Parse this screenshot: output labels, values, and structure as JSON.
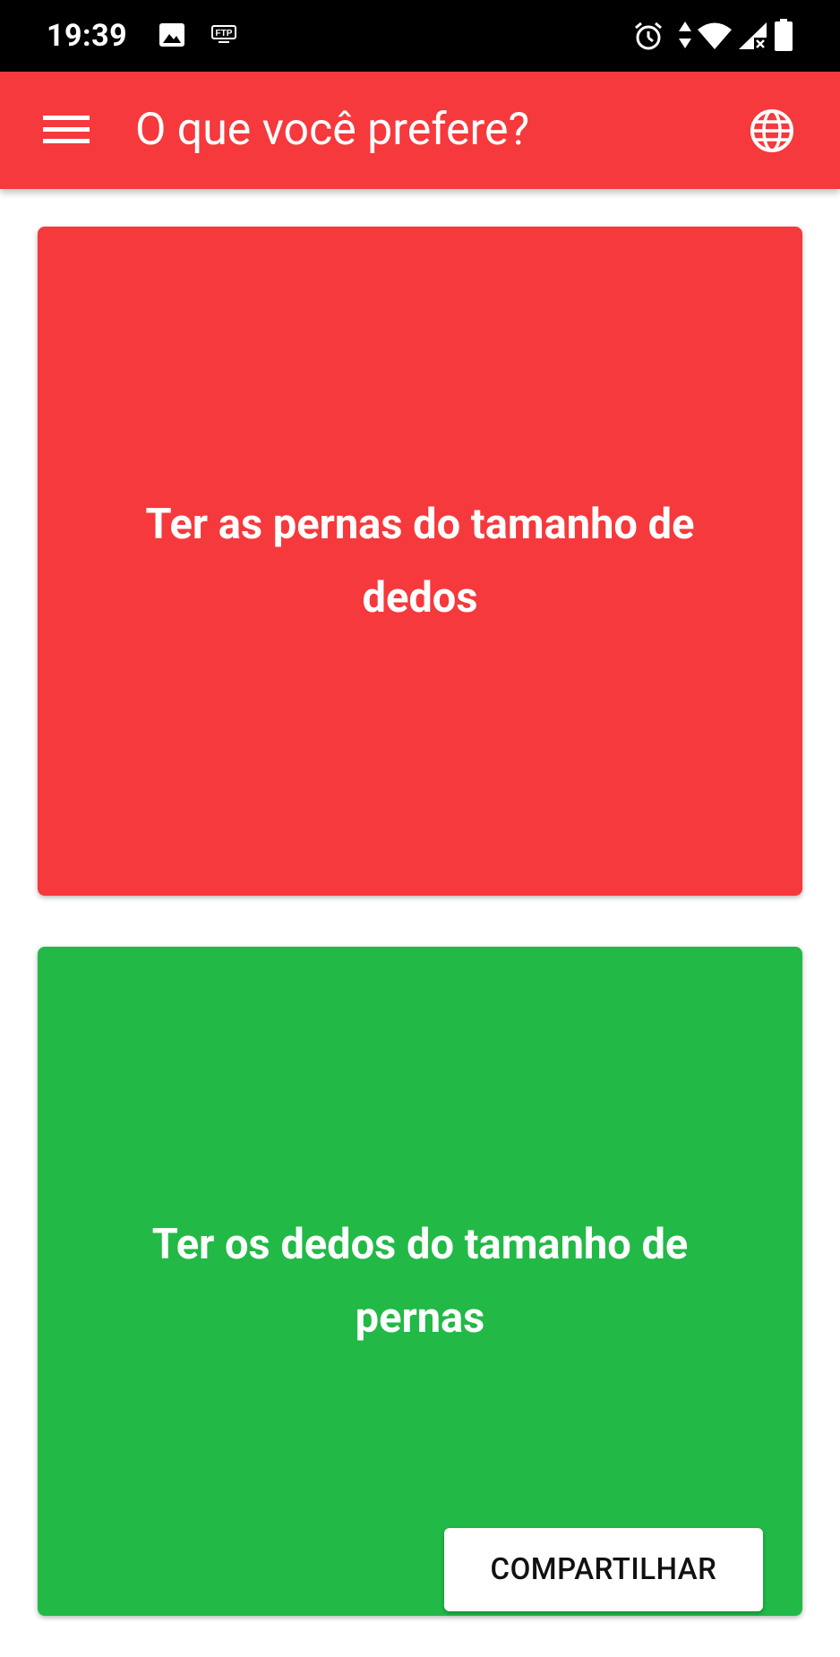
{
  "status_bar": {
    "time": "19:39",
    "left_icons": [
      "image-icon",
      "ftp-icon"
    ],
    "right_icons": [
      "alarm-icon",
      "data-arrows-icon",
      "wifi-icon",
      "signal-icon",
      "battery-icon"
    ],
    "ftp_label": "FTP"
  },
  "app_bar": {
    "title": "O que você prefere?",
    "menu_icon": "menu-icon",
    "language_icon": "globe-icon",
    "color": "#f5393c"
  },
  "options": [
    {
      "text": "Ter as pernas do tamanho de dedos",
      "color": "#f5393c"
    },
    {
      "text": "Ter os dedos do tamanho de pernas",
      "color": "#22b947"
    }
  ],
  "share_button": {
    "label": "COMPARTILHAR"
  }
}
